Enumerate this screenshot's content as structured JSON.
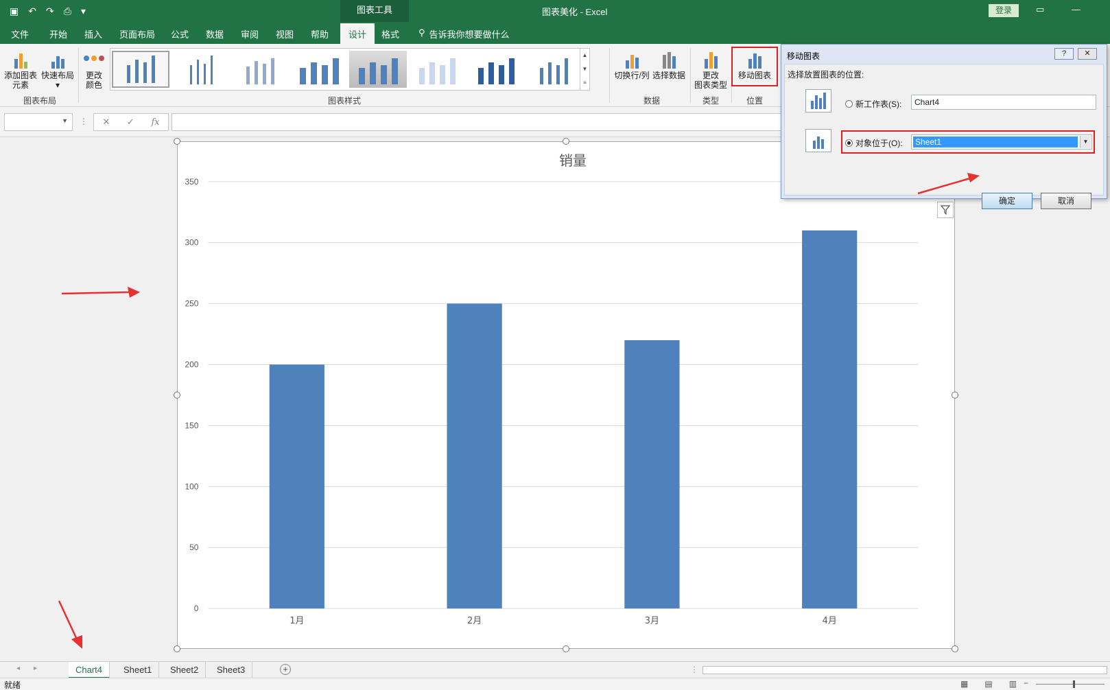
{
  "window": {
    "app_title": "图表美化 -  Excel",
    "context_tab_title": "图表工具",
    "login_label": "登录"
  },
  "tabs": [
    {
      "label": "文件"
    },
    {
      "label": "开始"
    },
    {
      "label": "插入"
    },
    {
      "label": "页面布局"
    },
    {
      "label": "公式"
    },
    {
      "label": "数据"
    },
    {
      "label": "审阅"
    },
    {
      "label": "视图"
    },
    {
      "label": "帮助"
    },
    {
      "label": "设计"
    },
    {
      "label": "格式"
    }
  ],
  "active_tab": "设计",
  "tell_me": "告诉我你想要做什么",
  "ribbon": {
    "add_element": "添加图表元素",
    "add_element_l1": "添加图表",
    "add_element_l2": "元素",
    "quick_layout": "快速布局",
    "change_colors_l1": "更改",
    "change_colors_l2": "颜色",
    "group_layout": "图表布局",
    "group_styles": "图表样式",
    "switch_row_col": "切换行/列",
    "select_data": "选择数据",
    "group_data": "数据",
    "change_type_l1": "更改",
    "change_type_l2": "图表类型",
    "group_type": "类型",
    "move_chart": "移动图表",
    "group_location": "位置"
  },
  "formula_bar": {
    "fx": "fx"
  },
  "chart_data": {
    "type": "bar",
    "title": "销量",
    "categories": [
      "1月",
      "2月",
      "3月",
      "4月"
    ],
    "values": [
      200,
      250,
      220,
      310
    ],
    "ylim": [
      0,
      350
    ],
    "yticks": [
      0,
      50,
      100,
      150,
      200,
      250,
      300,
      350
    ],
    "grid": true,
    "bar_color": "#4f81bd"
  },
  "sheet_tabs": [
    {
      "label": "Chart4",
      "active": true
    },
    {
      "label": "Sheet1",
      "active": false
    },
    {
      "label": "Sheet2",
      "active": false
    },
    {
      "label": "Sheet3",
      "active": false
    }
  ],
  "status": {
    "ready": "就绪"
  },
  "dialog": {
    "title": "移动图表",
    "help": "?",
    "close": "✕",
    "prompt": "选择放置图表的位置:",
    "new_sheet_label": "新工作表(S):",
    "new_sheet_value": "Chart4",
    "object_in_label": "对象位于(O):",
    "object_in_value": "Sheet1",
    "ok": "确定",
    "cancel": "取消"
  },
  "colors": {
    "excel_green": "#217346",
    "highlight": "#e02020"
  }
}
